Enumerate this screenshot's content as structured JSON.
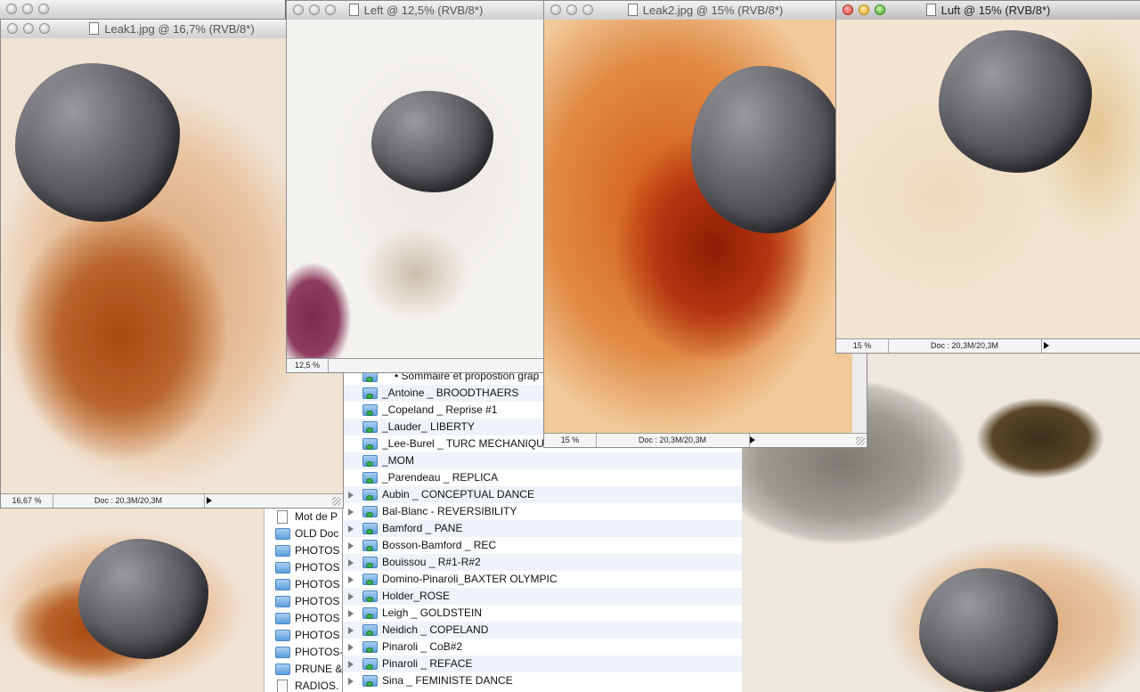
{
  "windows": {
    "leak1": {
      "title": "Leak1.jpg @ 16,7% (RVB/8*)",
      "zoom": "16,67 %",
      "doc": "Doc : 20,3M/20,3M"
    },
    "left": {
      "title": "Left @ 12,5% (RVB/8*)",
      "zoom": "12,5 %"
    },
    "leak2": {
      "title": "Leak2.jpg @ 15% (RVB/8*)",
      "zoom": "15 %",
      "doc": "Doc : 20,3M/20,3M"
    },
    "luft": {
      "title": "Luft @ 15% (RVB/8*)",
      "zoom": "15 %",
      "doc": "Doc : 20,3M/20,3M"
    }
  },
  "finder": {
    "items": [
      "• Sommaire et propostion grap",
      "_Antoine _ BROODTHAERS",
      "_Copeland _ Reprise #1",
      "_Lauder_ LIBERTY",
      "_Lee-Burel _ TURC MECHANIQUE",
      "_MOM",
      "_Parendeau _ REPLICA",
      "Aubin _ CONCEPTUAL DANCE",
      "Bal-Blanc - REVERSIBILITY",
      "Bamford _ PANE",
      "Bosson-Bamford _ REC",
      "Bouissou _ R#1-R#2",
      "Domino-Pinaroli_BAXTER OLYMPIC",
      "Holder_ROSE",
      "Leigh _ GOLDSTEIN",
      "Neidich _ COPELAND",
      "Pinaroli _ CoB#2",
      "Pinaroli _ REFACE",
      "Sina _ FEMINISTE DANCE"
    ]
  },
  "finder2": {
    "items": [
      "Mot de P",
      "OLD Doc",
      "PHOTOS",
      "PHOTOS",
      "PHOTOS",
      "PHOTOS",
      "PHOTOS",
      "PHOTOS",
      "PHOTOS-",
      "PRUNE &",
      "RADIOS."
    ]
  }
}
